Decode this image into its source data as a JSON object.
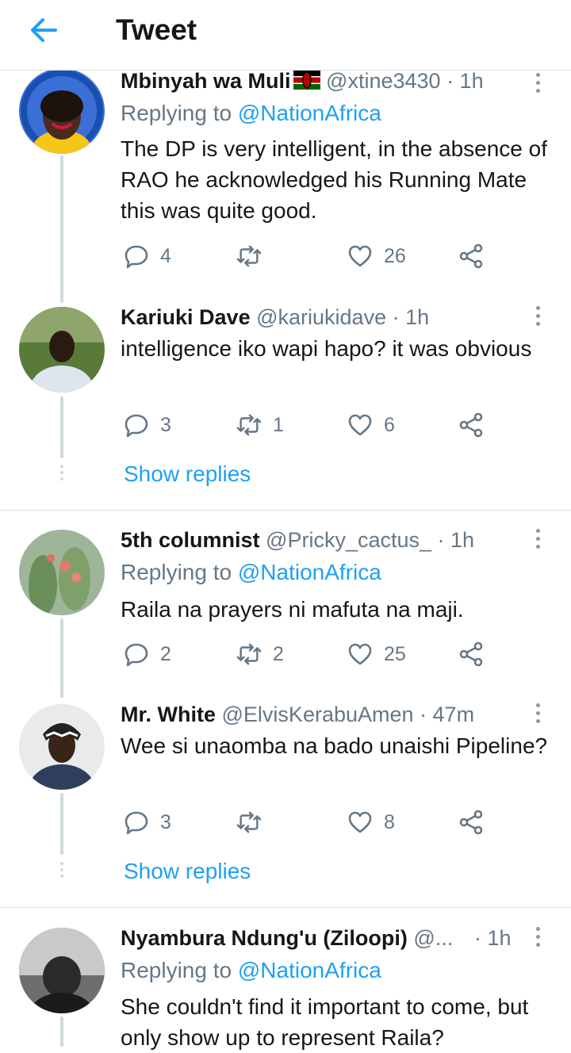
{
  "header": {
    "title": "Tweet",
    "back_icon": "arrow-left-icon"
  },
  "colors": {
    "accent": "#1da1f2",
    "secondary_text": "#657786",
    "divider": "#d8dde1"
  },
  "tweets": [
    {
      "name": "Mbinyah wa Muli",
      "flag": "kenya-flag-emoji",
      "handle": "@xtine3430",
      "time": "· 1h",
      "replying_prefix": "Replying to",
      "replying_to": "@NationAfrica",
      "text": "The DP is very intelligent, in the absence of RAO he acknowledged his Running Mate this was quite good.",
      "replies": "4",
      "retweets": "",
      "likes": "26"
    },
    {
      "name": "Kariuki Dave",
      "handle": "@kariukidave",
      "time": "· 1h",
      "text": "intelligence iko wapi hapo? it was obvious",
      "replies": "3",
      "retweets": "1",
      "likes": "6",
      "show_replies": "Show replies"
    },
    {
      "name": "5th columnist",
      "handle": "@Pricky_cactus_",
      "time": "· 1h",
      "replying_prefix": "Replying to",
      "replying_to": "@NationAfrica",
      "text": "Raila na prayers ni mafuta na maji.",
      "replies": "2",
      "retweets": "2",
      "likes": "25"
    },
    {
      "name": "Mr. White",
      "handle": "@ElvisKerabuAmen",
      "time": "· 47m",
      "text": "Wee si unaomba na bado unaishi Pipeline?",
      "replies": "3",
      "retweets": "",
      "likes": "8",
      "show_replies": "Show replies"
    },
    {
      "name": "Nyambura Ndung'u (Ziloopi)",
      "handle": "@...",
      "time": "· 1h",
      "replying_prefix": "Replying to",
      "replying_to": "@NationAfrica",
      "text": "She couldn't find it important to come, but only show up to represent Raila?"
    }
  ]
}
